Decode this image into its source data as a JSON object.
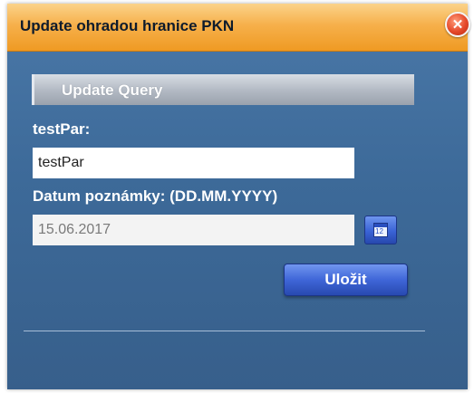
{
  "dialog": {
    "title": "Update ohradou hranice PKN",
    "close_icon": "close-icon"
  },
  "section": {
    "title": "Update Query"
  },
  "form": {
    "testpar_label": "testPar:",
    "testpar_value": "testPar",
    "date_label": "Datum poznámky: (DD.MM.YYYY)",
    "date_value": "15.06.2017",
    "calendar_icon": "calendar-icon",
    "save_label": "Uložit"
  },
  "colors": {
    "titlebar": "#f6b04b",
    "dialog_bg": "#3d6a99",
    "button": "#3f66d8",
    "close": "#e5482a"
  }
}
